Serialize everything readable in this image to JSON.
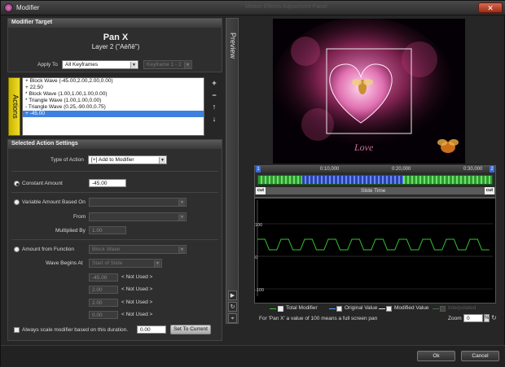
{
  "window": {
    "title": "Modifier",
    "ghost_title": "Motion Effects    Adjustment Panel",
    "close_label": "✕"
  },
  "modifier_target": {
    "header": "Modifier Target",
    "target_name": "Pan X",
    "layer_name": "Layer 2 (\"Aéñê\")",
    "apply_to_label": "Apply To",
    "apply_to_value": "All Keyframes",
    "keyframe_value": "Keyframe 1 - 2"
  },
  "actions": {
    "bar_label": "Actions",
    "items": [
      {
        "label": "+ Block Wave (-45.00,2.00,2.00,0.00)"
      },
      {
        "label": "+ 22.50"
      },
      {
        "label": "* Block Wave (1.00,1.00,1.00,0.00)"
      },
      {
        "label": "* Triangle Wave (1.00,1.00,0.00)"
      },
      {
        "label": "- Triangle Wave (0.25,-90.00,0.75)"
      },
      {
        "label": "+ -45.00"
      }
    ],
    "add_icon": "+",
    "remove_icon": "−",
    "up_icon": "↑",
    "down_icon": "↓"
  },
  "settings": {
    "header": "Selected Action Settings",
    "type_label": "Type of Action",
    "type_value": "[+] Add to Modifier",
    "constant_label": "Constant Amount",
    "constant_value": "-45.00",
    "variable_label": "Variable Amount Based On",
    "variable_value": "",
    "from_label": "From",
    "from_value": "",
    "multiplied_label": "Multiplied By",
    "multiplied_value": "1.00",
    "function_label": "Amount from Function",
    "function_value": "Block Wave",
    "wave_begins_label": "Wave Begins At",
    "wave_begins_value": "Start of Slide",
    "params": [
      {
        "value": "-45.00",
        "note": "< Not Used >"
      },
      {
        "value": "2.00",
        "note": "< Not Used >"
      },
      {
        "value": "2.00",
        "note": "< Not Used >"
      },
      {
        "value": "0.00",
        "note": "< Not Used >"
      }
    ],
    "scale_label": "Always scale modifier based on this duration.",
    "scale_value": "0.00",
    "set_current_label": "Set To Current"
  },
  "preview": {
    "strip_label": "Preview",
    "caption": "Love",
    "play_icon": "▶",
    "loop_icon": "↻",
    "pin_icon": "⌖"
  },
  "timeline": {
    "start_marker": "1",
    "end_marker": "2",
    "ticks": [
      "0:10,000",
      "0:20,000",
      "0:30,000"
    ],
    "left_cut": "cut",
    "right_cut": "cut",
    "center_label": "Slide Time"
  },
  "graph": {
    "y_ticks": [
      "100",
      "0",
      "-100"
    ],
    "legend_total": "Total Modifier",
    "legend_original": "Original Value",
    "legend_modified": "Modified Value",
    "legend_interp": "Interpolated",
    "note": "For 'Pan X' a value of 100 means a full screen pan",
    "zoom_label": "Zoom",
    "zoom_value": "0",
    "zoom_unit": "%"
  },
  "footer": {
    "ok_label": "Ok",
    "cancel_label": "Cancel"
  },
  "colors": {
    "accent_select": "#3e80e0",
    "actions_bar": "#e0cc20",
    "wave_green": "#32c832",
    "track_blue": "#4060e0"
  }
}
